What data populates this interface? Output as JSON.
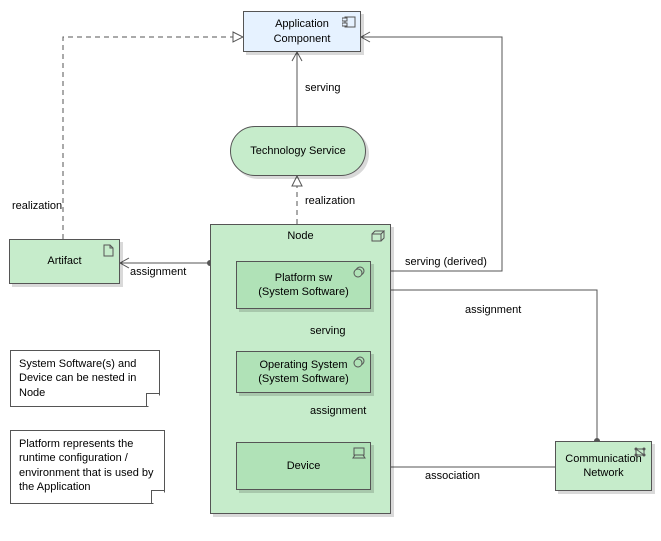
{
  "application_component": {
    "label": "Application\nComponent"
  },
  "technology_service": {
    "label": "Technology Service"
  },
  "artifact": {
    "label": "Artifact"
  },
  "node": {
    "title": "Node",
    "platform_sw": {
      "label": "Platform sw\n(System Software)"
    },
    "operating_system": {
      "label": "Operating System\n(System Software)"
    },
    "device": {
      "label": "Device"
    }
  },
  "communication_network": {
    "label": "Communication\nNetwork"
  },
  "notes": {
    "nesting": "System Software(s) and Device can be nested in Node",
    "platform": "Platform represents the runtime configuration / environment that is used by the Application"
  },
  "edges": {
    "serving1": "serving",
    "realization_left": "realization",
    "realization_mid": "realization",
    "assignment_left": "assignment",
    "serving_derived": "serving (derived)",
    "assignment_right": "assignment",
    "serving_inner": "serving",
    "assignment_inner": "assignment",
    "association": "association"
  },
  "chart_data": {
    "type": "diagram",
    "notation": "ArchiMate",
    "elements": [
      {
        "id": "app",
        "name": "Application Component",
        "type": "ApplicationComponent",
        "layer": "Application"
      },
      {
        "id": "tsvc",
        "name": "Technology Service",
        "type": "TechnologyService",
        "layer": "Technology"
      },
      {
        "id": "art",
        "name": "Artifact",
        "type": "Artifact",
        "layer": "Technology"
      },
      {
        "id": "node",
        "name": "Node",
        "type": "Node",
        "layer": "Technology"
      },
      {
        "id": "psw",
        "name": "Platform sw (System Software)",
        "type": "SystemSoftware",
        "layer": "Technology",
        "parent": "node"
      },
      {
        "id": "os",
        "name": "Operating System (System Software)",
        "type": "SystemSoftware",
        "layer": "Technology",
        "parent": "node"
      },
      {
        "id": "dev",
        "name": "Device",
        "type": "Device",
        "layer": "Technology",
        "parent": "node"
      },
      {
        "id": "net",
        "name": "Communication Network",
        "type": "CommunicationNetwork",
        "layer": "Technology"
      }
    ],
    "relationships": [
      {
        "source": "tsvc",
        "target": "app",
        "type": "Serving",
        "label": "serving"
      },
      {
        "source": "art",
        "target": "app",
        "type": "Realization",
        "label": "realization"
      },
      {
        "source": "node",
        "target": "tsvc",
        "type": "Realization",
        "label": "realization"
      },
      {
        "source": "node",
        "target": "art",
        "type": "Assignment",
        "label": "assignment"
      },
      {
        "source": "psw",
        "target": "app",
        "type": "Serving",
        "label": "serving (derived)",
        "derived": true
      },
      {
        "source": "net",
        "target": "psw",
        "type": "Assignment",
        "label": "assignment"
      },
      {
        "source": "os",
        "target": "psw",
        "type": "Serving",
        "label": "serving"
      },
      {
        "source": "dev",
        "target": "os",
        "type": "Assignment",
        "label": "assignment"
      },
      {
        "source": "net",
        "target": "dev",
        "type": "Association",
        "label": "association"
      }
    ],
    "notes": [
      "System Software(s) and Device can be nested in Node",
      "Platform represents the runtime configuration / environment that is used by the Application"
    ]
  }
}
